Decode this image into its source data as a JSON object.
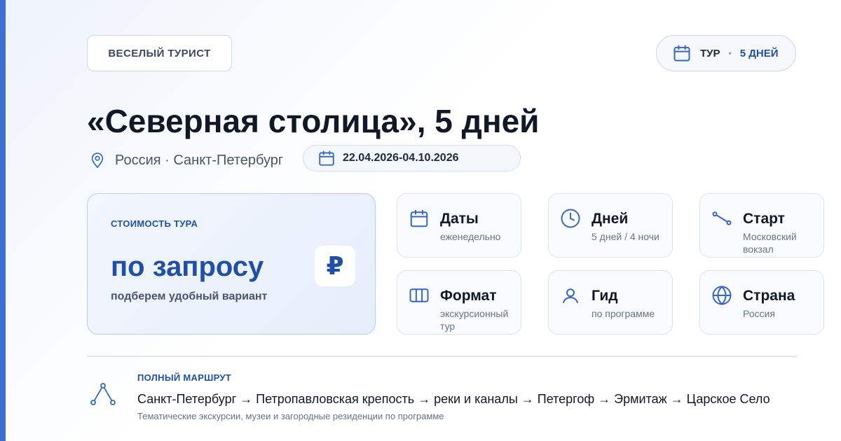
{
  "brand": {
    "label": "ВЕСЕЛЫЙ ТУРИСТ"
  },
  "tour_pill": {
    "type": "ТУР",
    "separator": "•",
    "duration": "5 ДНЕЙ"
  },
  "title": "«Северная столица», 5 дней",
  "location": "Россия · Санкт-Петербург",
  "date_range": "22.04.2026-04.10.2026",
  "price": {
    "label": "СТОИМОСТЬ ТУРА",
    "value": "по запросу",
    "subtitle": "подберем удобный вариант",
    "currency_symbol": "₽"
  },
  "info_cards": [
    {
      "icon": "calendar-icon",
      "title": "Даты",
      "value": "еженедельно"
    },
    {
      "icon": "clock-icon",
      "title": "Дней",
      "value": "5 дней / 4 ночи"
    },
    {
      "icon": "route-start-icon",
      "title": "Старт",
      "value": "Московский вокзал"
    },
    {
      "icon": "columns-icon",
      "title": "Формат",
      "value": "экскурсионный тур"
    },
    {
      "icon": "person-icon",
      "title": "Гид",
      "value": "по программе"
    },
    {
      "icon": "globe-icon",
      "title": "Страна",
      "value": "Россия"
    }
  ],
  "route": {
    "label": "ПОЛНЫЙ МАРШРУТ",
    "text": "Санкт-Петербург → Петропавловская крепость → реки и каналы → Петергоф → Эрмитаж → Царское Село",
    "note": "Тематические экскурсии, музеи и загородные резиденции по программе"
  },
  "colors": {
    "accent": "#3b6fd4",
    "primary_text": "#1f4fa8",
    "icon": "#3566c4"
  }
}
